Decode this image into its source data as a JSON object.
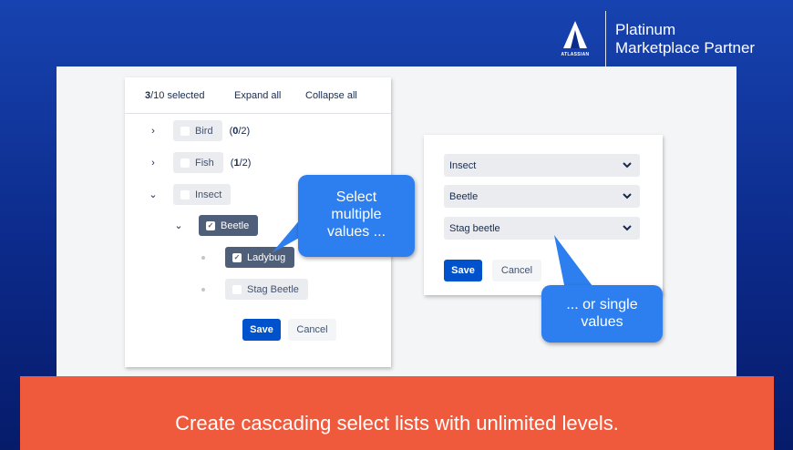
{
  "partner": {
    "logo_word": "ATLASSIAN",
    "line1": "Platinum",
    "line2": "Marketplace Partner"
  },
  "tree": {
    "selected_count": "3",
    "selected_total": "/10 selected",
    "expand_all": "Expand all",
    "collapse_all": "Collapse all",
    "nodes": [
      {
        "label": "Bird",
        "count_open": "(",
        "count_sel": "0",
        "count_rest": "/2)"
      },
      {
        "label": "Fish",
        "count_open": "(",
        "count_sel": "1",
        "count_rest": "/2)"
      },
      {
        "label": "Insect"
      },
      {
        "label": "Beetle"
      },
      {
        "label": "Ladybug"
      },
      {
        "label": "Stag Beetle"
      }
    ],
    "save": "Save",
    "cancel": "Cancel"
  },
  "selects": {
    "fields": [
      {
        "value": "Insect"
      },
      {
        "value": "Beetle"
      },
      {
        "value": "Stag beetle"
      }
    ],
    "save": "Save",
    "cancel": "Cancel"
  },
  "callouts": {
    "multiple_l1": "Select",
    "multiple_l2": "multiple",
    "multiple_l3": "values ...",
    "single_l1": "... or single",
    "single_l2": "values"
  },
  "banner": "Create cascading select lists with unlimited levels.",
  "colors": {
    "background_top": "#1743b0",
    "background_bottom": "#061b6a",
    "callout": "#2d7ff0",
    "banner": "#f05a3c",
    "primary_button": "#0052cc",
    "selected_pill": "#505f79"
  }
}
